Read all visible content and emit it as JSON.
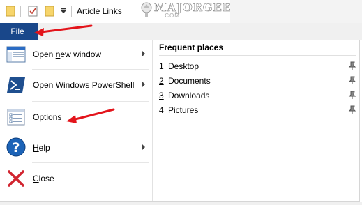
{
  "window": {
    "title": "Article Links",
    "quick_access": [
      {
        "name": "folder-icon"
      },
      {
        "name": "checkmark-properties-icon"
      },
      {
        "name": "new-folder-icon"
      },
      {
        "name": "customize-quick-access-dropdown"
      }
    ]
  },
  "watermark": {
    "text": "MAJORGEEKS",
    "sub": ".COM"
  },
  "ribbon": {
    "file_tab_label": "File"
  },
  "file_menu": {
    "items": [
      {
        "label_pre": "Open ",
        "label_accel": "n",
        "label_post": "ew window",
        "icon": "new-window-icon",
        "has_submenu": true
      },
      {
        "label_pre": "Open Windows Powe",
        "label_accel": "r",
        "label_post": "Shell",
        "icon": "powershell-icon",
        "has_submenu": true
      },
      {
        "label_pre": "",
        "label_accel": "O",
        "label_post": "ptions",
        "icon": "options-icon",
        "has_submenu": false
      },
      {
        "label_pre": "",
        "label_accel": "H",
        "label_post": "elp",
        "icon": "help-icon",
        "has_submenu": true
      },
      {
        "label_pre": "",
        "label_accel": "C",
        "label_post": "lose",
        "icon": "close-icon",
        "has_submenu": false
      }
    ]
  },
  "frequent_places": {
    "header": "Frequent places",
    "items": [
      {
        "num": "1",
        "name": "Desktop"
      },
      {
        "num": "2",
        "name": "Documents"
      },
      {
        "num": "3",
        "name": "Downloads"
      },
      {
        "num": "4",
        "name": "Pictures"
      }
    ]
  },
  "colors": {
    "file_tab": "#19478a",
    "annotation_arrow": "#e3141b",
    "close_x": "#d1242f",
    "help_circle": "#1c63b7",
    "powershell": "#1f4f8f"
  }
}
